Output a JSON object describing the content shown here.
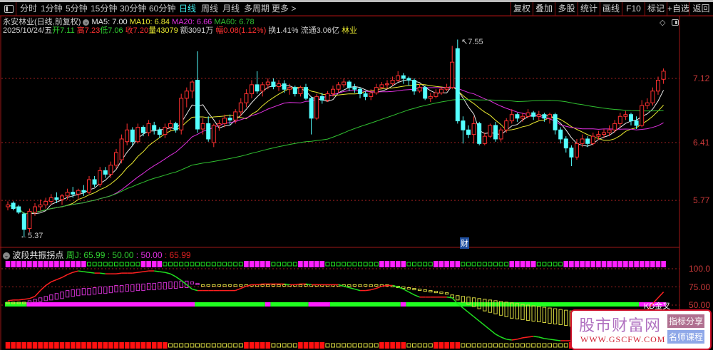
{
  "toolbar": {
    "tabs": [
      "分时",
      "1分钟",
      "5分钟",
      "15分钟",
      "30分钟",
      "60分钟",
      "日线",
      "周线",
      "月线",
      "多周期",
      "更多 >"
    ],
    "active_tab": "日线",
    "buttons": [
      "复权",
      "叠加",
      "多股",
      "统计",
      "画线",
      "F10",
      "标记",
      "+自选",
      "返回"
    ]
  },
  "header": {
    "title": "永安林业(日线,前复权)",
    "ma5": "MA5: 7.00",
    "ma10": "MA10: 6.84",
    "ma20": "MA20: 6.66",
    "ma60": "MA60: 6.78",
    "date": "2025/10/24/五",
    "open": "开7.11",
    "high": "高7.23",
    "low": "低7.06",
    "close": "收7.20",
    "volume": "量43079",
    "amount": "额3091万",
    "change": "幅0.08(1.12%)",
    "turnover": "换1.41%",
    "float_cap": "流通3.06亿",
    "sector": "林业"
  },
  "colors": {
    "up": "#ff3030",
    "down": "#54ffff",
    "ma5": "#e8e8e8",
    "ma10": "#e8e830",
    "ma20": "#e030e0",
    "ma60": "#30c030",
    "grid": "#a02020"
  },
  "price_axis": {
    "labels": [
      "7.12",
      "6.41",
      "5.77"
    ]
  },
  "annotations": {
    "low_label": "5.37",
    "high_label": "7.55",
    "finance_marker": "财"
  },
  "chart_data": {
    "type": "candlestick",
    "ohlc": [
      [
        5.7,
        5.76,
        5.66,
        5.72
      ],
      [
        5.74,
        5.76,
        5.66,
        5.68
      ],
      [
        5.7,
        5.72,
        5.62,
        5.64
      ],
      [
        5.62,
        5.64,
        5.37,
        5.45
      ],
      [
        5.46,
        5.68,
        5.42,
        5.65
      ],
      [
        5.64,
        5.74,
        5.6,
        5.7
      ],
      [
        5.7,
        5.78,
        5.66,
        5.72
      ],
      [
        5.72,
        5.8,
        5.68,
        5.76
      ],
      [
        5.76,
        5.84,
        5.72,
        5.8
      ],
      [
        5.8,
        5.86,
        5.74,
        5.78
      ],
      [
        5.78,
        5.84,
        5.72,
        5.82
      ],
      [
        5.82,
        5.9,
        5.78,
        5.86
      ],
      [
        5.86,
        5.92,
        5.8,
        5.84
      ],
      [
        5.84,
        5.9,
        5.78,
        5.88
      ],
      [
        5.88,
        5.94,
        5.82,
        5.86
      ],
      [
        5.86,
        6.04,
        5.84,
        6.0
      ],
      [
        6.0,
        6.04,
        5.92,
        5.95
      ],
      [
        5.95,
        6.14,
        5.92,
        6.1
      ],
      [
        6.1,
        6.14,
        6.02,
        6.06
      ],
      [
        6.06,
        6.2,
        6.02,
        6.16
      ],
      [
        6.16,
        6.34,
        6.12,
        6.3
      ],
      [
        6.22,
        6.5,
        6.18,
        6.45
      ],
      [
        6.42,
        6.62,
        6.38,
        6.55
      ],
      [
        6.55,
        6.58,
        6.38,
        6.42
      ],
      [
        6.42,
        6.62,
        6.4,
        6.58
      ],
      [
        6.58,
        6.6,
        6.48,
        6.52
      ],
      [
        6.52,
        6.66,
        6.48,
        6.62
      ],
      [
        6.6,
        6.64,
        6.5,
        6.55
      ],
      [
        6.55,
        6.58,
        6.46,
        6.5
      ],
      [
        6.5,
        6.62,
        6.46,
        6.58
      ],
      [
        6.58,
        6.66,
        6.54,
        6.62
      ],
      [
        6.62,
        6.64,
        6.52,
        6.55
      ],
      [
        6.55,
        6.95,
        6.5,
        6.9
      ],
      [
        6.9,
        7.02,
        6.8,
        6.98
      ],
      [
        6.98,
        7.1,
        6.9,
        7.08
      ],
      [
        7.1,
        7.42,
        6.52,
        6.56
      ],
      [
        6.56,
        6.68,
        6.5,
        6.62
      ],
      [
        6.62,
        6.7,
        6.42,
        6.45
      ],
      [
        6.41,
        6.62,
        6.36,
        6.6
      ],
      [
        6.6,
        6.66,
        6.54,
        6.62
      ],
      [
        6.62,
        6.72,
        6.58,
        6.68
      ],
      [
        6.68,
        6.72,
        6.6,
        6.66
      ],
      [
        6.66,
        6.78,
        6.62,
        6.75
      ],
      [
        6.75,
        6.9,
        6.7,
        6.85
      ],
      [
        6.85,
        7.0,
        6.8,
        6.95
      ],
      [
        6.95,
        7.1,
        6.9,
        7.05
      ],
      [
        7.05,
        7.2,
        6.95,
        6.98
      ],
      [
        6.98,
        7.08,
        6.92,
        7.05
      ],
      [
        7.05,
        7.12,
        7.0,
        7.08
      ],
      [
        7.08,
        7.12,
        7.0,
        7.03
      ],
      [
        7.03,
        7.1,
        6.98,
        7.06
      ],
      [
        7.06,
        7.1,
        6.96,
        7.0
      ],
      [
        7.0,
        7.06,
        6.94,
        7.02
      ],
      [
        7.02,
        7.04,
        6.92,
        6.95
      ],
      [
        6.95,
        7.04,
        6.92,
        7.02
      ],
      [
        7.02,
        7.06,
        6.88,
        6.9
      ],
      [
        6.9,
        6.92,
        6.5,
        6.68
      ],
      [
        6.68,
        6.95,
        6.66,
        6.92
      ],
      [
        6.92,
        6.96,
        6.84,
        6.88
      ],
      [
        6.88,
        6.98,
        6.86,
        6.95
      ],
      [
        6.95,
        7.04,
        6.92,
        7.0
      ],
      [
        7.0,
        7.08,
        6.96,
        7.05
      ],
      [
        7.05,
        7.12,
        7.02,
        7.08
      ],
      [
        7.08,
        7.1,
        6.98,
        7.02
      ],
      [
        7.02,
        7.06,
        6.96,
        7.0
      ],
      [
        7.0,
        7.02,
        6.9,
        6.95
      ],
      [
        6.95,
        6.98,
        6.88,
        6.92
      ],
      [
        6.92,
        7.0,
        6.88,
        6.96
      ],
      [
        6.96,
        7.06,
        6.94,
        7.02
      ],
      [
        7.02,
        7.08,
        7.0,
        7.05
      ],
      [
        7.05,
        7.1,
        7.0,
        7.06
      ],
      [
        7.06,
        7.14,
        7.04,
        7.1
      ],
      [
        7.1,
        7.2,
        7.08,
        7.15
      ],
      [
        7.15,
        7.18,
        7.06,
        7.12
      ],
      [
        7.12,
        7.14,
        7.04,
        7.1
      ],
      [
        7.1,
        7.12,
        6.94,
        6.98
      ],
      [
        6.98,
        7.06,
        6.96,
        7.02
      ],
      [
        7.02,
        7.04,
        6.88,
        6.9
      ],
      [
        6.9,
        6.96,
        6.86,
        6.92
      ],
      [
        6.92,
        7.0,
        6.9,
        6.96
      ],
      [
        6.96,
        7.02,
        6.94,
        7.0
      ],
      [
        7.0,
        7.06,
        6.98,
        7.02
      ],
      [
        7.02,
        7.48,
        7.0,
        7.3
      ],
      [
        7.45,
        7.55,
        6.62,
        6.65
      ],
      [
        6.65,
        6.7,
        6.4,
        6.55
      ],
      [
        6.55,
        6.6,
        6.46,
        6.5
      ],
      [
        6.5,
        6.7,
        6.4,
        6.62
      ],
      [
        6.62,
        6.64,
        6.38,
        6.4
      ],
      [
        6.4,
        6.52,
        6.38,
        6.48
      ],
      [
        6.48,
        6.62,
        6.46,
        6.6
      ],
      [
        6.6,
        6.64,
        6.42,
        6.45
      ],
      [
        6.45,
        6.58,
        6.42,
        6.55
      ],
      [
        6.55,
        6.68,
        6.52,
        6.65
      ],
      [
        6.65,
        6.78,
        6.62,
        6.72
      ],
      [
        6.72,
        6.74,
        6.64,
        6.68
      ],
      [
        6.68,
        6.74,
        6.64,
        6.7
      ],
      [
        6.7,
        6.78,
        6.68,
        6.74
      ],
      [
        6.74,
        6.76,
        6.66,
        6.7
      ],
      [
        6.7,
        6.76,
        6.66,
        6.72
      ],
      [
        6.72,
        6.74,
        6.64,
        6.68
      ],
      [
        6.68,
        6.74,
        6.62,
        6.72
      ],
      [
        6.72,
        6.74,
        6.5,
        6.55
      ],
      [
        6.55,
        6.58,
        6.4,
        6.45
      ],
      [
        6.45,
        6.48,
        6.3,
        6.35
      ],
      [
        6.35,
        6.38,
        6.15,
        6.25
      ],
      [
        6.25,
        6.45,
        6.22,
        6.4
      ],
      [
        6.4,
        6.5,
        6.36,
        6.45
      ],
      [
        6.45,
        6.48,
        6.36,
        6.4
      ],
      [
        6.4,
        6.52,
        6.38,
        6.48
      ],
      [
        6.48,
        6.54,
        6.44,
        6.5
      ],
      [
        6.5,
        6.56,
        6.46,
        6.52
      ],
      [
        6.52,
        6.6,
        6.48,
        6.55
      ],
      [
        6.55,
        6.66,
        6.52,
        6.62
      ],
      [
        6.62,
        6.74,
        6.58,
        6.7
      ],
      [
        6.7,
        6.76,
        6.66,
        6.72
      ],
      [
        6.72,
        6.74,
        6.6,
        6.65
      ],
      [
        6.65,
        6.7,
        6.56,
        6.6
      ],
      [
        6.6,
        6.88,
        6.58,
        6.82
      ],
      [
        6.82,
        6.9,
        6.78,
        6.85
      ],
      [
        6.85,
        7.02,
        6.82,
        6.98
      ],
      [
        6.98,
        7.14,
        6.94,
        7.1
      ],
      [
        7.11,
        7.23,
        7.06,
        7.2
      ]
    ],
    "ohlc_order": [
      "open",
      "high",
      "low",
      "close"
    ],
    "moving_averages": [
      5,
      10,
      20,
      60
    ],
    "y_ticks": [
      7.12,
      6.41,
      5.77
    ],
    "low_point": 5.37,
    "high_point": 7.55
  },
  "indicator": {
    "name": "波段共振拐点",
    "values": [
      "周J: 65.99",
      ": 50.00",
      ": 50.00",
      ": 65.99"
    ],
    "axis_labels": [
      "100.0",
      "75.00",
      "50.00"
    ],
    "cross_label": "KD金叉",
    "j_line": [
      56,
      57,
      57,
      58,
      59,
      62,
      70,
      77,
      82,
      85,
      88,
      92,
      95,
      97,
      96,
      95,
      94,
      94,
      93,
      93,
      93,
      94,
      94,
      94,
      95,
      96,
      97,
      97,
      96,
      95,
      93,
      89,
      84,
      78,
      72,
      70,
      70,
      70,
      70,
      70,
      70,
      70,
      70,
      73,
      76,
      78,
      78,
      79,
      79,
      79,
      79,
      79,
      78,
      78,
      79,
      79,
      78,
      78,
      78,
      78,
      78,
      78,
      76,
      74,
      72,
      70,
      70,
      71,
      73,
      76,
      77,
      77,
      75,
      72,
      68,
      64,
      61,
      61,
      61,
      61,
      61,
      61,
      60,
      52,
      46,
      40,
      34,
      28,
      22,
      16,
      10,
      6,
      3,
      2,
      3,
      5,
      6,
      7,
      6,
      4,
      3,
      2,
      1,
      1,
      1,
      2,
      3,
      3,
      4,
      5,
      6,
      8,
      10,
      13,
      17,
      22,
      28,
      35,
      43,
      52,
      60,
      68
    ],
    "bar_top": [
      54,
      54,
      54,
      54,
      56,
      58,
      60,
      62,
      64,
      66,
      68,
      70,
      71,
      72,
      73,
      73,
      74,
      75,
      75,
      76,
      77,
      77,
      78,
      78,
      79,
      79,
      80,
      80,
      81,
      81,
      82,
      82,
      83,
      83,
      82,
      80,
      78,
      78,
      78,
      78,
      78,
      78,
      78,
      78,
      78,
      78,
      78,
      78,
      78,
      78,
      78,
      78,
      78,
      78,
      78,
      78,
      78,
      78,
      78,
      78,
      78,
      78,
      78,
      78,
      78,
      78,
      78,
      78,
      78,
      78,
      78,
      77,
      76,
      75,
      74,
      73,
      72,
      71,
      70,
      69,
      68,
      67,
      64,
      63,
      62,
      61,
      60,
      59,
      58,
      57,
      56,
      55,
      54,
      53,
      52,
      51,
      50,
      49,
      48,
      47,
      46,
      45,
      44,
      43,
      42,
      41,
      40,
      40,
      39,
      39,
      38,
      38,
      37,
      37,
      36,
      36,
      null,
      null,
      null,
      null,
      null,
      null
    ],
    "bar_bottom": [
      52,
      52,
      52,
      52,
      53,
      54,
      55,
      56,
      57,
      58,
      59,
      61,
      62,
      63,
      64,
      64,
      65,
      66,
      66,
      67,
      68,
      68,
      69,
      69,
      70,
      70,
      71,
      71,
      72,
      72,
      73,
      73,
      74,
      74,
      79,
      78,
      76,
      76,
      76,
      76,
      76,
      76,
      76,
      76,
      76,
      76,
      76,
      76,
      76,
      76,
      76,
      76,
      76,
      76,
      76,
      76,
      76,
      76,
      76,
      76,
      76,
      76,
      76,
      76,
      76,
      76,
      76,
      76,
      76,
      76,
      76,
      75,
      74,
      73,
      72,
      71,
      70,
      69,
      68,
      67,
      66,
      65,
      60,
      57,
      54,
      51,
      48,
      45,
      42,
      40,
      38,
      36,
      34,
      32,
      31,
      30,
      29,
      28,
      27,
      26,
      25,
      24,
      23,
      22,
      21,
      20,
      19,
      18,
      18,
      17,
      17,
      16,
      16,
      15,
      15,
      14,
      null,
      null,
      null,
      null,
      null,
      null
    ],
    "top_row": [
      [
        "filled",
        15
      ],
      [
        "hollow",
        10
      ],
      [
        "filled",
        4
      ],
      [
        "hollow",
        15
      ],
      [
        "filled",
        5
      ],
      [
        "hollow",
        5
      ],
      [
        "filled",
        5
      ],
      [
        "hollow",
        10
      ],
      [
        "filled",
        5
      ],
      [
        "hollow",
        5
      ],
      [
        "filled",
        5
      ],
      [
        "hollow",
        9
      ],
      [
        "filled",
        5
      ],
      [
        "hollow",
        5
      ],
      [
        "filled",
        19
      ]
    ],
    "bottom_row": [
      [
        "filled",
        30
      ],
      [
        "hollow",
        14
      ],
      [
        "filled",
        5
      ],
      [
        "hollow",
        5
      ],
      [
        "filled",
        5
      ],
      [
        "hollow",
        10
      ],
      [
        "filled",
        5
      ],
      [
        "hollow",
        5
      ],
      [
        "filled",
        5
      ],
      [
        "hollow",
        20
      ],
      [
        "filled",
        18
      ]
    ],
    "mid_band": [
      [
        "green",
        4
      ],
      [
        "magenta",
        31
      ],
      [
        "green",
        13
      ],
      [
        "magenta",
        1
      ],
      [
        "green",
        7
      ],
      [
        "magenta",
        4
      ],
      [
        "green",
        13
      ],
      [
        "magenta",
        1
      ],
      [
        "green",
        43
      ],
      [
        "magenta",
        5
      ]
    ]
  },
  "watermark": {
    "title": "股市财富网",
    "url": "WWW.GSCFW.COM",
    "button1": "指标分享",
    "button2": "名师课程"
  }
}
